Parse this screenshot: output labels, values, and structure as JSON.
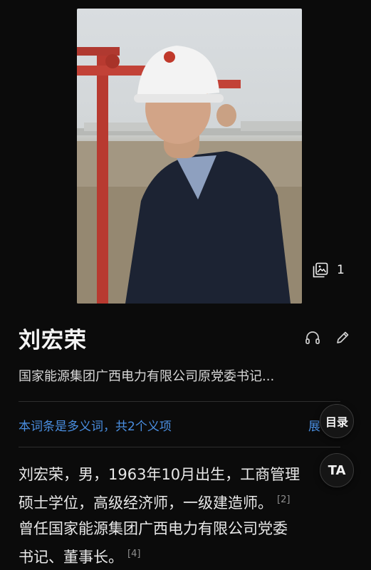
{
  "article": {
    "title": "刘宏荣",
    "subtitle": "国家能源集团广西电力有限公司原党委书记...",
    "image_count": "1",
    "polysemy_note": "本词条是多义词，共2个义项",
    "expand_label": "展",
    "toc_label": "目录",
    "ta_label": "TA",
    "body_lines": [
      {
        "text": "刘宏荣，男，1963年10月出生，工商管理",
        "cite": ""
      },
      {
        "text": "硕士学位，高级经济师，一级建造师。",
        "cite": "[2]"
      },
      {
        "text": "曾任国家能源集团广西电力有限公司党委",
        "cite": ""
      },
      {
        "text": "书记、董事长。",
        "cite": "[4]"
      }
    ]
  },
  "icons": {
    "gallery": "image-gallery-icon",
    "listen": "headphones-icon",
    "edit": "pencil-edit-icon"
  },
  "colors": {
    "background": "#0b0b0b",
    "link": "#4a8fe2",
    "text": "#e8e8e8"
  }
}
